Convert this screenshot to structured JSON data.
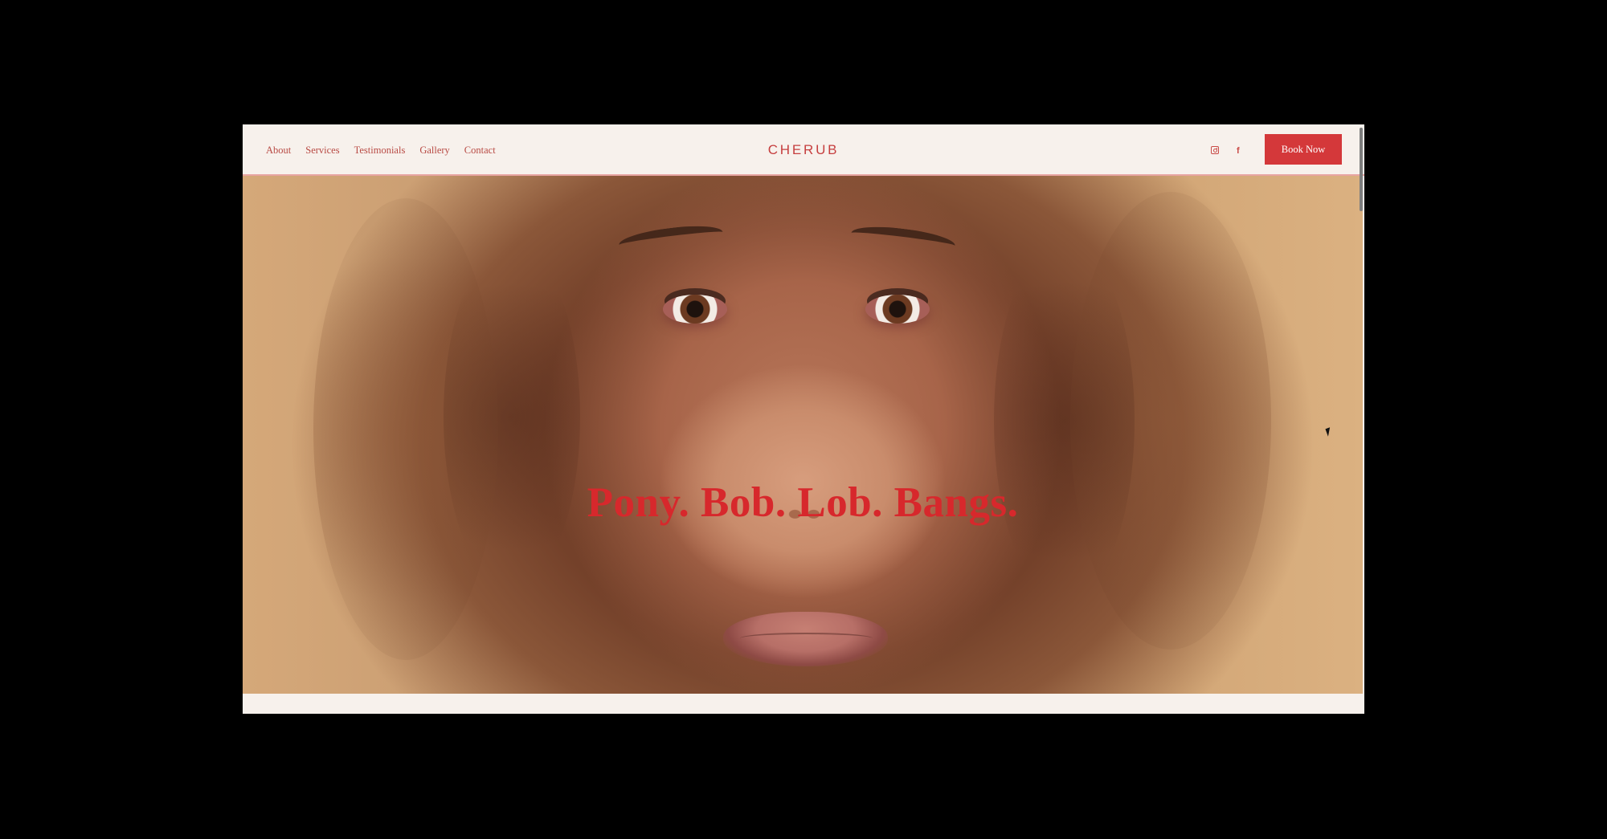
{
  "site": {
    "brand": "CHERUB",
    "nav": [
      {
        "label": "About"
      },
      {
        "label": "Services"
      },
      {
        "label": "Testimonials"
      },
      {
        "label": "Gallery"
      },
      {
        "label": "Contact"
      }
    ],
    "cta_label": "Book Now",
    "social": [
      {
        "icon": "instagram-icon"
      },
      {
        "icon": "facebook-icon"
      }
    ],
    "facebook_glyph": "f"
  },
  "hero": {
    "headline": "Pony. Bob. Lob. Bangs."
  },
  "colors": {
    "accent": "#d4383a",
    "header_background": "#f7f1ec",
    "headline": "#d7282c",
    "page_background": "#000000"
  }
}
